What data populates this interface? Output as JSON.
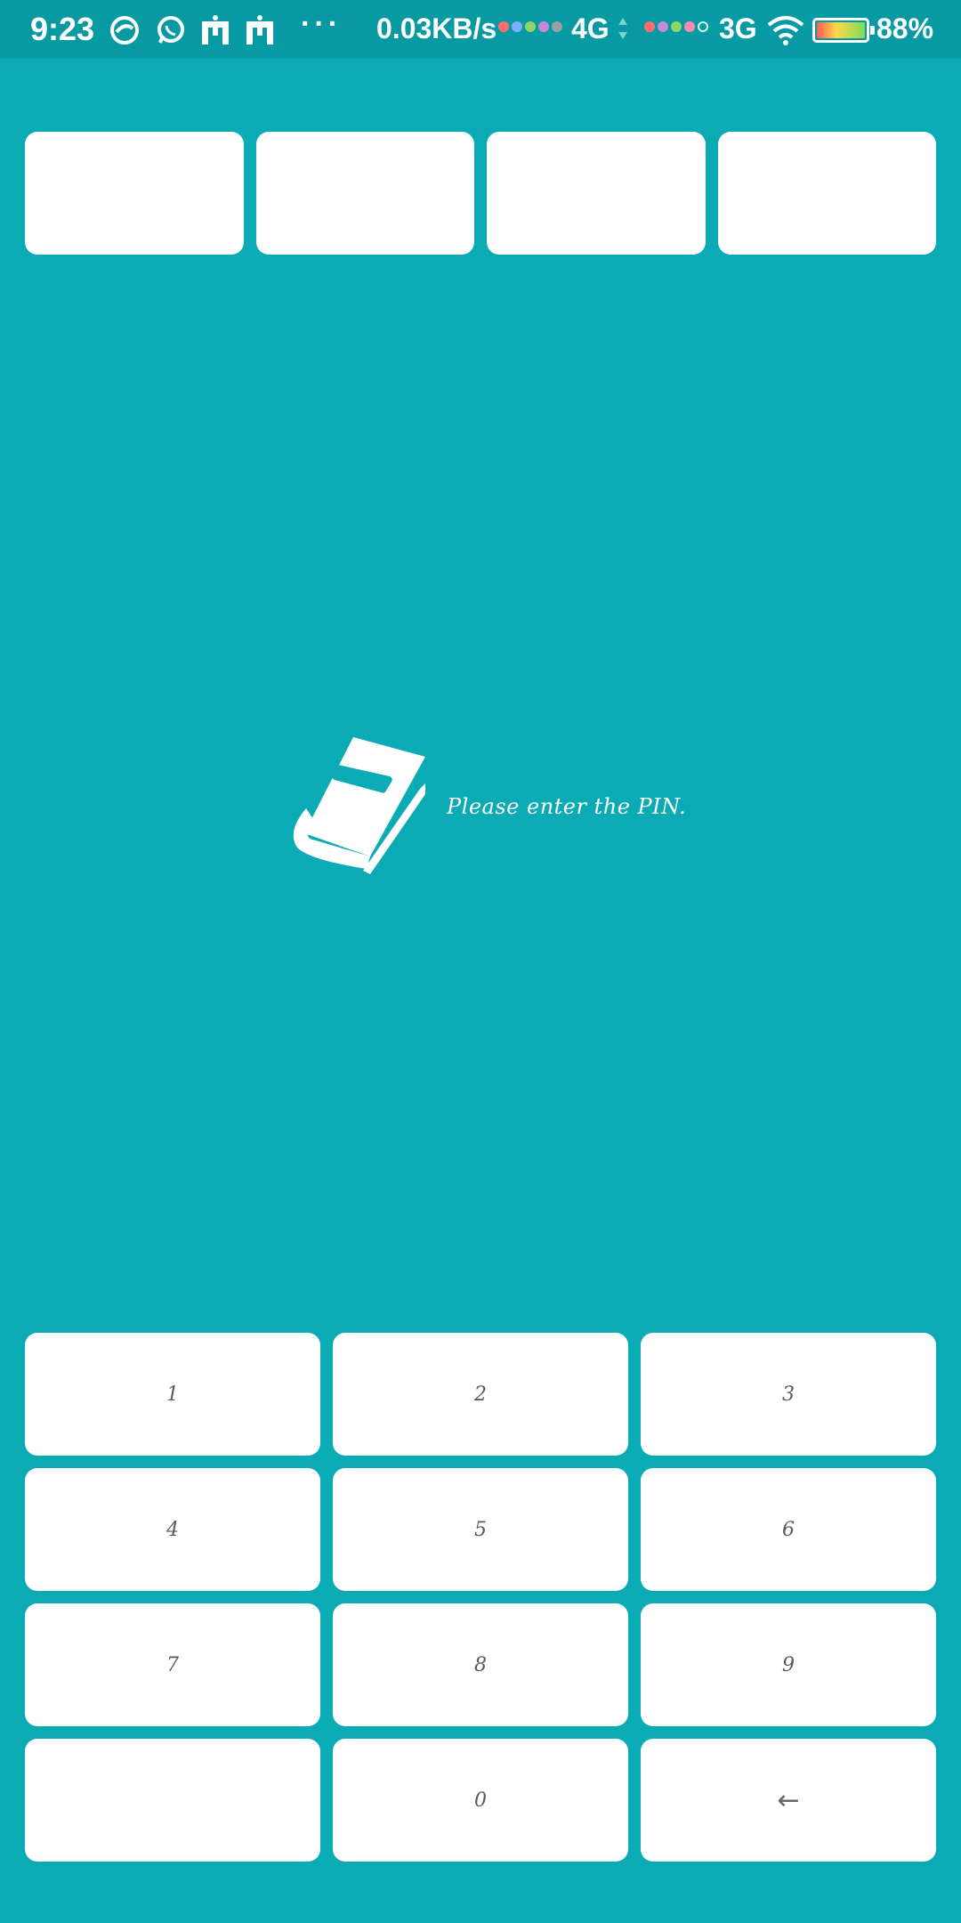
{
  "status_bar": {
    "time": "9:23",
    "overflow": "···",
    "network_speed": "0.03KB/s",
    "sim1_type": "4G",
    "sim2_type": "3G",
    "battery": "88%",
    "icons": [
      "browser-icon",
      "whatsapp-icon",
      "mi-icon",
      "mi-icon",
      "wifi-icon",
      "battery-icon"
    ]
  },
  "pin": {
    "slots": [
      "",
      "",
      "",
      ""
    ],
    "prompt": "Please enter the PIN.",
    "icon": "book-icon"
  },
  "keypad": {
    "keys": [
      "1",
      "2",
      "3",
      "4",
      "5",
      "6",
      "7",
      "8",
      "9",
      "",
      "0",
      "←"
    ]
  },
  "colors": {
    "background": "#0aabb4",
    "status_bar": "#089aa3",
    "surface": "#ffffff",
    "key_text": "#555b5e"
  }
}
